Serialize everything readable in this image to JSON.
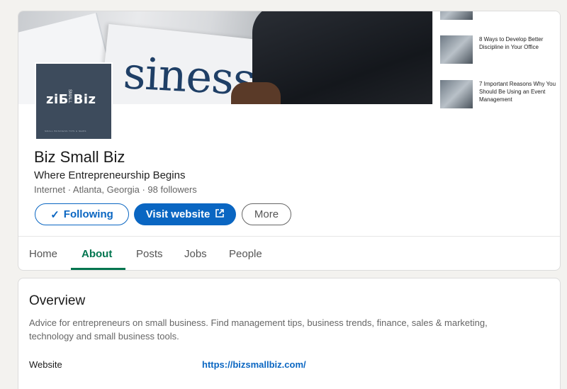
{
  "company": {
    "logo_main": "ziƂ Biz",
    "logo_small": "SMALL",
    "logo_tagline": "SMALL BUSINESS TIPS & NEWS",
    "name": "Biz Small Biz",
    "tagline": "Where Entrepreneurship Begins",
    "meta": "Internet · Atlanta, Georgia · 98 followers"
  },
  "banner": {
    "word": "siness",
    "articles": [
      {
        "title": ""
      },
      {
        "title": "8 Ways to Develop Better Discipline in Your Office"
      },
      {
        "title": "7 Important Reasons Why You Should Be Using an Event Management"
      }
    ]
  },
  "actions": {
    "following_icon": "check-icon",
    "following_label": "Following",
    "visit_label": "Visit website",
    "visit_icon": "external-link-icon",
    "more_label": "More"
  },
  "tabs": [
    {
      "label": "Home"
    },
    {
      "label": "About"
    },
    {
      "label": "Posts"
    },
    {
      "label": "Jobs"
    },
    {
      "label": "People"
    }
  ],
  "active_tab": "About",
  "overview": {
    "title": "Overview",
    "description": "Advice for entrepreneurs on small business. Find management tips, business trends, finance, sales & marketing, technology and small business tools.",
    "website_label": "Website",
    "website_url": "https://bizsmallbiz.com/"
  },
  "colors": {
    "accent": "#0a66c2",
    "active_tab": "#01754f",
    "logo_bg": "#3d4b5c"
  }
}
